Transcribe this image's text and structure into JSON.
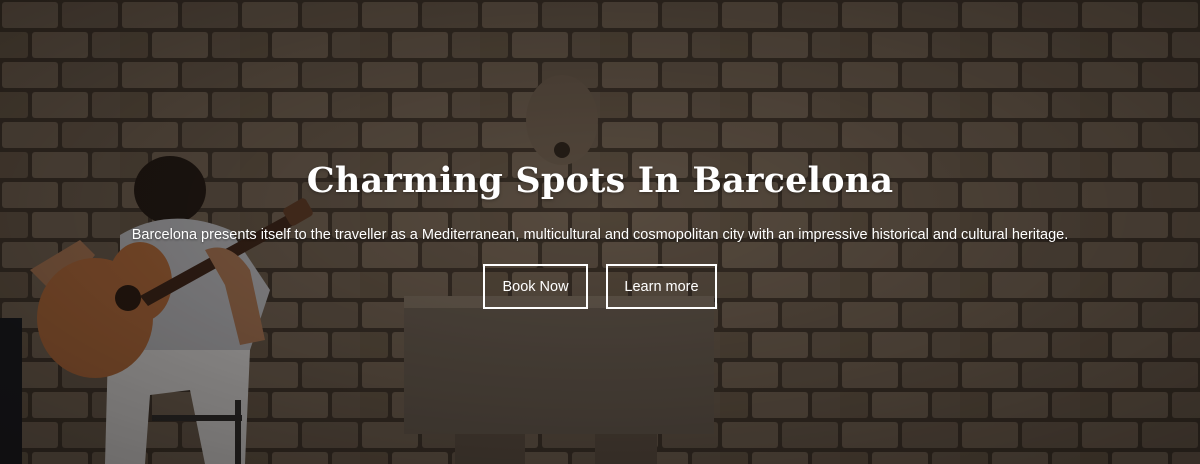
{
  "hero": {
    "title": "Charming Spots In Barcelona",
    "subtitle": "Barcelona presents itself to the traveller as a Mediterranean, multicultural and cosmopolitan city with an impressive historical and cultural heritage.",
    "buttons": {
      "primary_label": "Book Now",
      "secondary_label": "Learn more"
    }
  },
  "colors": {
    "text": "#ffffff",
    "button_border": "#ffffff",
    "stone_wall": "#6e6051",
    "mortar": "#3a3128"
  }
}
